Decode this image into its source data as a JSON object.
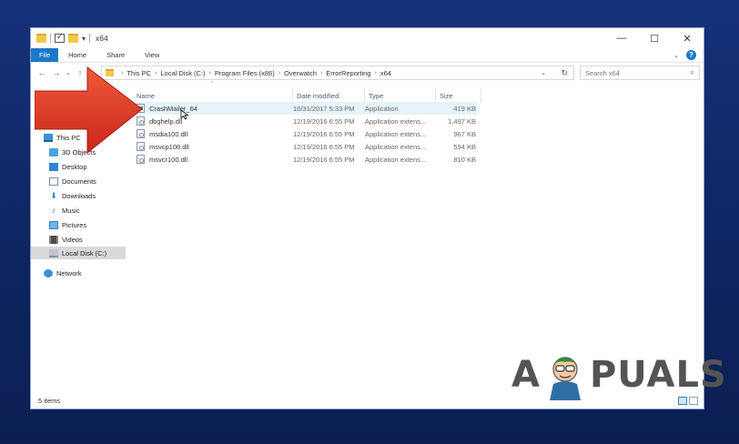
{
  "window": {
    "title": "x64"
  },
  "ribbon": {
    "tabs": [
      "File",
      "Home",
      "Share",
      "View"
    ]
  },
  "address": {
    "crumbs": [
      "This PC",
      "Local Disk (C:)",
      "Program Files (x86)",
      "Overwatch",
      "ErrorReporting",
      "x64"
    ]
  },
  "search": {
    "placeholder": "Search x64"
  },
  "nav": {
    "items": [
      {
        "label": "This PC",
        "icon": "computer-icon"
      },
      {
        "label": "3D Objects",
        "icon": "cube-icon"
      },
      {
        "label": "Desktop",
        "icon": "desktop-icon"
      },
      {
        "label": "Documents",
        "icon": "document-icon"
      },
      {
        "label": "Downloads",
        "icon": "download-icon"
      },
      {
        "label": "Music",
        "icon": "music-icon"
      },
      {
        "label": "Pictures",
        "icon": "picture-icon"
      },
      {
        "label": "Videos",
        "icon": "video-icon"
      },
      {
        "label": "Local Disk (C:)",
        "icon": "disk-icon"
      },
      {
        "label": "Network",
        "icon": "network-icon"
      }
    ]
  },
  "columns": {
    "name": "Name",
    "date": "Date modified",
    "type": "Type",
    "size": "Size"
  },
  "files": [
    {
      "name": "CrashMailer_64",
      "date": "10/31/2017 5:33 PM",
      "type": "Application",
      "size": "419 KB"
    },
    {
      "name": "dbghelp.dll",
      "date": "12/19/2016 6:55 PM",
      "type": "Application extens...",
      "size": "1,497 KB"
    },
    {
      "name": "msdia100.dll",
      "date": "12/19/2016 6:55 PM",
      "type": "Application extens...",
      "size": "967 KB"
    },
    {
      "name": "msvcp100.dll",
      "date": "12/19/2016 6:55 PM",
      "type": "Application extens...",
      "size": "594 KB"
    },
    {
      "name": "msvcr100.dll",
      "date": "12/19/2016 6:55 PM",
      "type": "Application extens...",
      "size": "810 KB"
    }
  ],
  "status": {
    "items": "5 items"
  },
  "watermark": {
    "left": "A",
    "right": "PUALS"
  },
  "colors": {
    "accent": "#1979ca",
    "arrow": "#e03a22",
    "selection": "#e5f3fb"
  }
}
